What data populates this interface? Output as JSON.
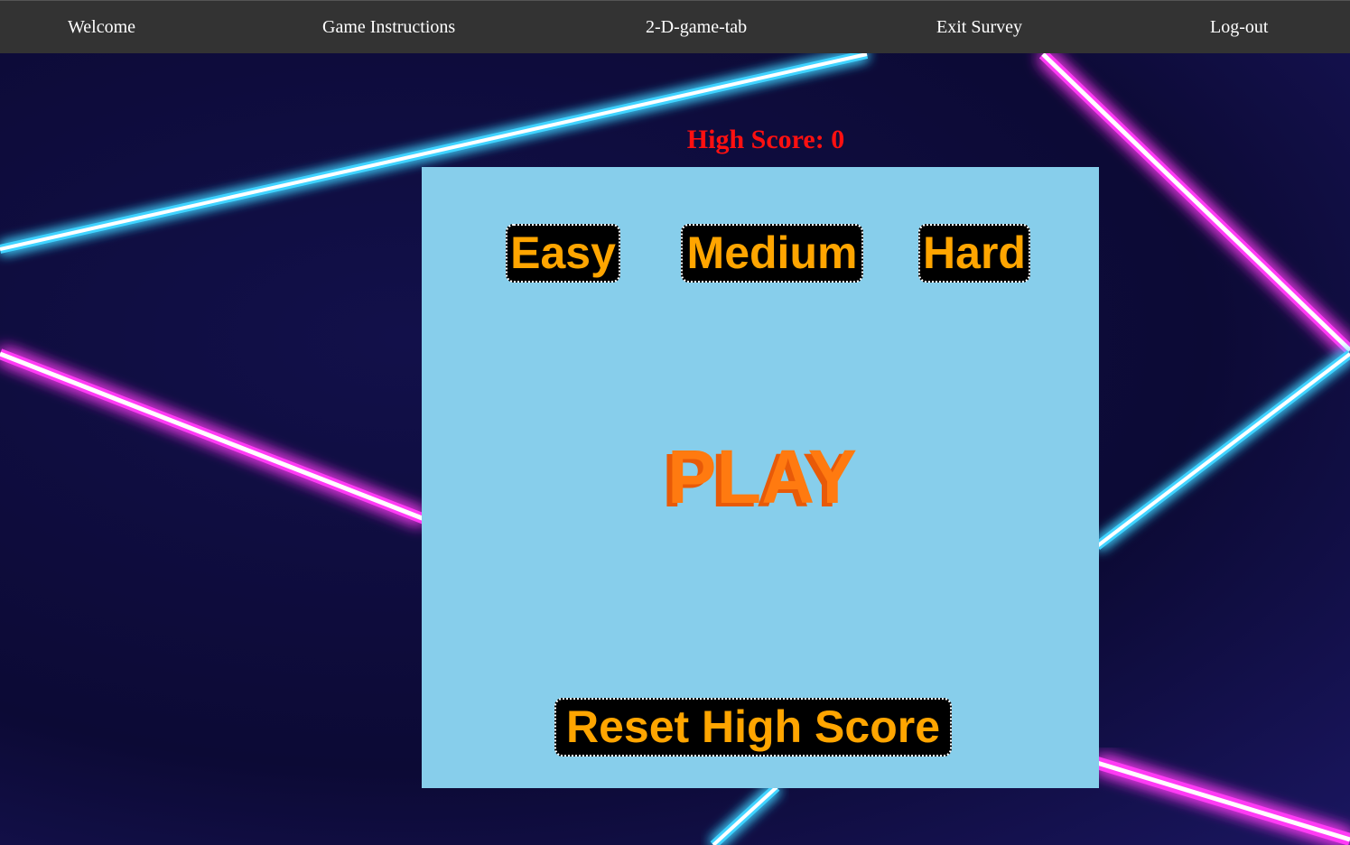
{
  "nav": {
    "items": [
      {
        "label": "Welcome"
      },
      {
        "label": "Game Instructions"
      },
      {
        "label": "2-D-game-tab"
      },
      {
        "label": "Exit Survey"
      },
      {
        "label": "Log-out"
      }
    ]
  },
  "score": {
    "high_score_text": "High Score: 0"
  },
  "game": {
    "difficulty": {
      "easy_label": "Easy",
      "medium_label": "Medium",
      "hard_label": "Hard"
    },
    "play_label": "PLAY",
    "reset_label": "Reset High Score"
  },
  "colors": {
    "navbar": "#333333",
    "panel": "#87ceeb",
    "button_text": "#ffa500",
    "high_score": "#ff1010",
    "play_logo": "#ff7a10",
    "neon_blue": "#3fd3ff",
    "neon_pink": "#ff3af5"
  },
  "icons": {
    "play": "play-logo-icon"
  }
}
